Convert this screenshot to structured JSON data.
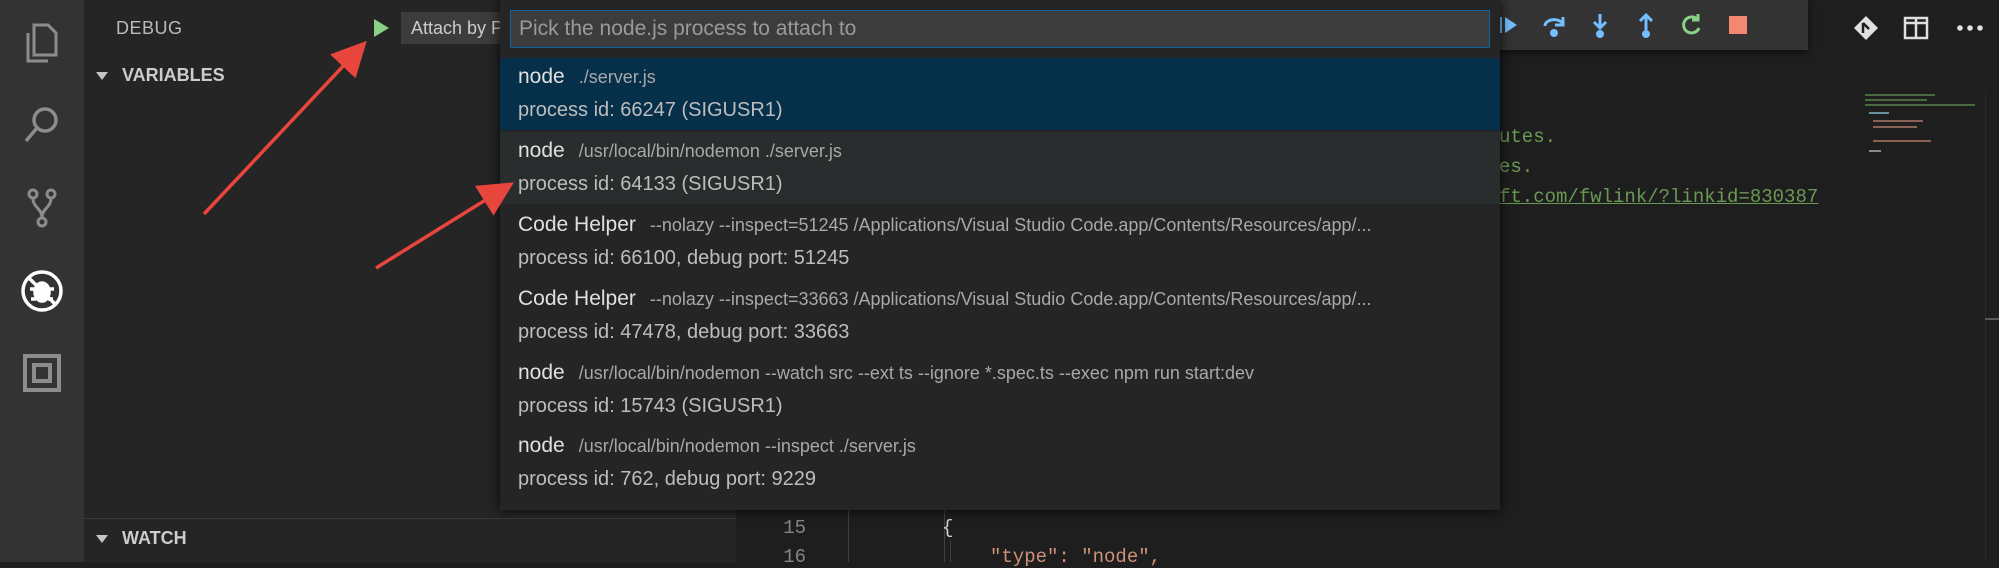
{
  "debug": {
    "title": "DEBUG",
    "config_value": "Attach by Process ID",
    "sections": {
      "variables": "VARIABLES",
      "watch": "WATCH"
    }
  },
  "quick_pick": {
    "placeholder": "Pick the node.js process to attach to",
    "items": [
      {
        "label": "node",
        "description": "./server.js",
        "detail": "process id: 66247 (SIGUSR1)",
        "state": "selected"
      },
      {
        "label": "node",
        "description": "/usr/local/bin/nodemon ./server.js",
        "detail": "process id: 64133 (SIGUSR1)",
        "state": "hover"
      },
      {
        "label": "Code Helper",
        "description": "--nolazy --inspect=51245 /Applications/Visual Studio Code.app/Contents/Resources/app/...",
        "detail": "process id: 66100, debug port: 51245",
        "state": "normal"
      },
      {
        "label": "Code Helper",
        "description": "--nolazy --inspect=33663 /Applications/Visual Studio Code.app/Contents/Resources/app/...",
        "detail": "process id: 47478, debug port: 33663",
        "state": "normal"
      },
      {
        "label": "node",
        "description": "/usr/local/bin/nodemon --watch src --ext ts --ignore *.spec.ts --exec npm run start:dev",
        "detail": "process id: 15743 (SIGUSR1)",
        "state": "normal"
      },
      {
        "label": "node",
        "description": "/usr/local/bin/nodemon --inspect ./server.js",
        "detail": "process id: 762, debug port: 9229",
        "state": "normal"
      }
    ]
  },
  "editor": {
    "comment_lines": [
      "utes.",
      "es.",
      "ft.com/fwlink/?linkid=830387"
    ],
    "line_numbers": [
      "15",
      "16"
    ],
    "code": [
      "{",
      "\"type\": \"node\","
    ]
  },
  "colors": {
    "accent_green": "#89d185",
    "arrow_red": "#e8453c",
    "stop_red": "#f48771",
    "selection_blue": "#062f4a"
  },
  "icons": {
    "activity": [
      "explorer-icon",
      "search-icon",
      "source-control-icon",
      "debug-icon",
      "extensions-icon"
    ],
    "debug_toolbar": [
      "continue-icon",
      "step-over-icon",
      "step-into-icon",
      "step-out-icon",
      "restart-icon",
      "stop-icon"
    ],
    "editor_actions": [
      "open-changes-icon",
      "split-editor-icon",
      "more-actions-icon"
    ]
  }
}
